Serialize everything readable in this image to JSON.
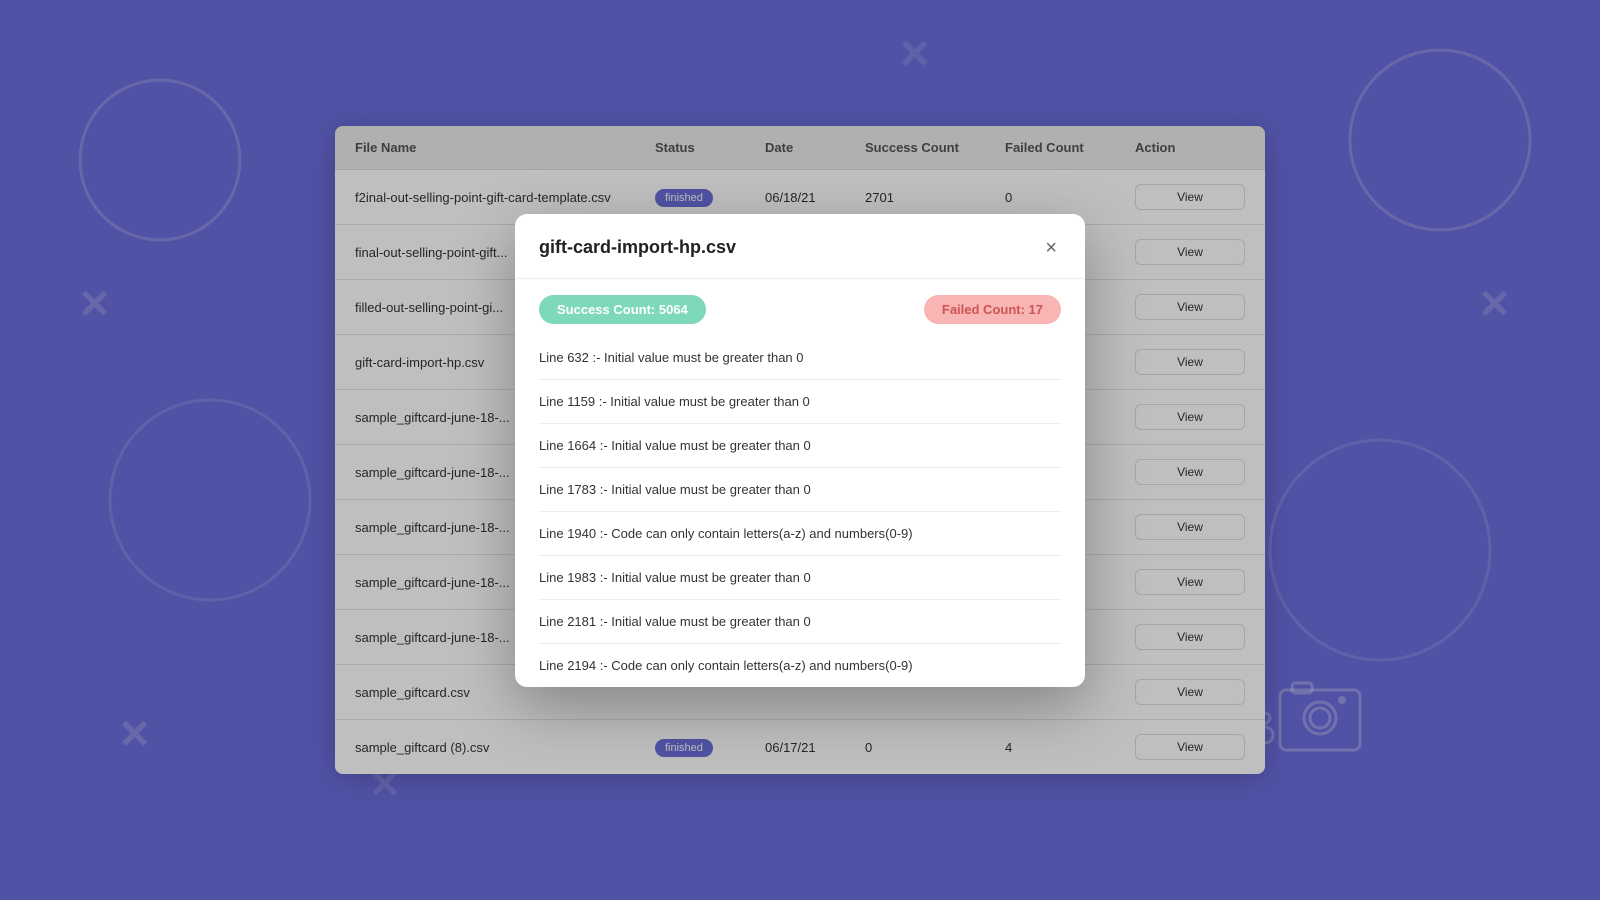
{
  "background": {
    "color": "#6b6edd"
  },
  "table": {
    "headers": [
      "File Name",
      "Status",
      "Date",
      "Success Count",
      "Failed Count",
      "Action"
    ],
    "rows": [
      {
        "fileName": "f2inal-out-selling-point-gift-card-template.csv",
        "status": "finished",
        "date": "06/18/21",
        "successCount": "2701",
        "failedCount": "0",
        "action": "View"
      },
      {
        "fileName": "final-out-selling-point-gift...",
        "status": "",
        "date": "",
        "successCount": "",
        "failedCount": "",
        "action": "View"
      },
      {
        "fileName": "filled-out-selling-point-gi...",
        "status": "",
        "date": "",
        "successCount": "",
        "failedCount": "",
        "action": "View"
      },
      {
        "fileName": "gift-card-import-hp.csv",
        "status": "",
        "date": "",
        "successCount": "",
        "failedCount": "",
        "action": "View"
      },
      {
        "fileName": "sample_giftcard-june-18-...",
        "status": "",
        "date": "",
        "successCount": "",
        "failedCount": "",
        "action": "View"
      },
      {
        "fileName": "sample_giftcard-june-18-...",
        "status": "",
        "date": "",
        "successCount": "",
        "failedCount": "",
        "action": "View"
      },
      {
        "fileName": "sample_giftcard-june-18-...",
        "status": "",
        "date": "",
        "successCount": "",
        "failedCount": "",
        "action": "View"
      },
      {
        "fileName": "sample_giftcard-june-18-...",
        "status": "",
        "date": "",
        "successCount": "",
        "failedCount": "",
        "action": "View"
      },
      {
        "fileName": "sample_giftcard-june-18-...",
        "status": "",
        "date": "",
        "successCount": "",
        "failedCount": "",
        "action": "View"
      },
      {
        "fileName": "sample_giftcard.csv",
        "status": "",
        "date": "",
        "successCount": "",
        "failedCount": "",
        "action": "View"
      },
      {
        "fileName": "sample_giftcard (8).csv",
        "status": "finished",
        "date": "06/17/21",
        "successCount": "0",
        "failedCount": "4",
        "action": "View"
      }
    ],
    "viewLabel": "View"
  },
  "modal": {
    "title": "gift-card-import-hp.csv",
    "successLabel": "Success Count: 5064",
    "failedLabel": "Failed Count: 17",
    "closeIcon": "×",
    "errors": [
      "Line 632 :- Initial value must be greater than 0",
      "Line 1159 :- Initial value must be greater than 0",
      "Line 1664 :- Initial value must be greater than 0",
      "Line 1783 :- Initial value must be greater than 0",
      "Line 1940 :- Code can only contain letters(a-z) and numbers(0-9)",
      "Line 1983 :- Initial value must be greater than 0",
      "Line 2181 :- Initial value must be greater than 0",
      "Line 2194 :- Code can only contain letters(a-z) and numbers(0-9)"
    ]
  },
  "status": {
    "finishedLabel": "finished"
  }
}
